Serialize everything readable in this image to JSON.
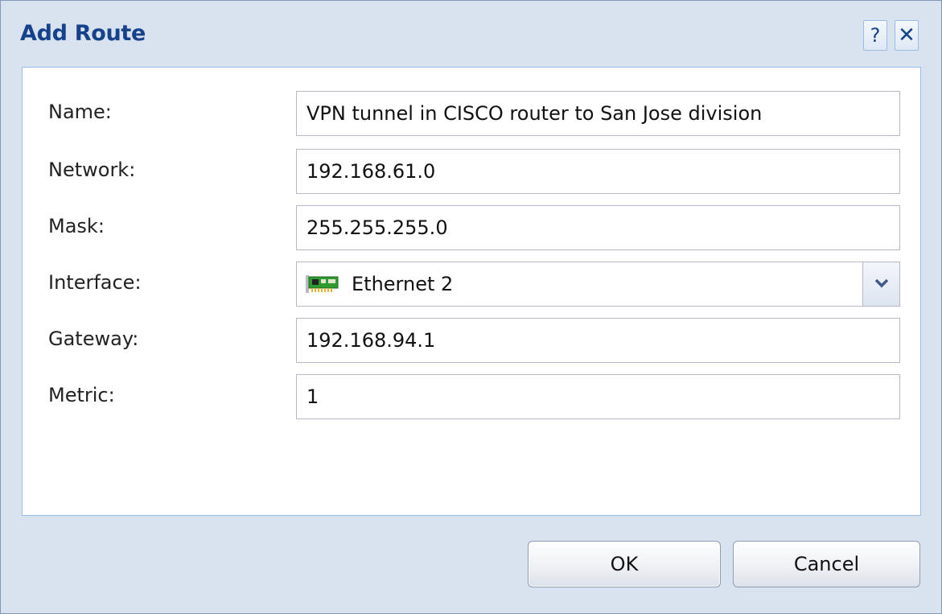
{
  "dialog": {
    "title": "Add Route",
    "help_button": "?",
    "close_button": "✕"
  },
  "form": {
    "name": {
      "label": "Name:",
      "value": "VPN tunnel in CISCO router to San Jose division"
    },
    "network": {
      "label": "Network:",
      "value": "192.168.61.0"
    },
    "mask": {
      "label": "Mask:",
      "value": "255.255.255.0"
    },
    "interface": {
      "label": "Interface:",
      "value": "Ethernet 2",
      "icon": "network-card-icon"
    },
    "gateway": {
      "label": "Gateway:",
      "value": "192.168.94.1"
    },
    "metric": {
      "label": "Metric:",
      "value": "1"
    }
  },
  "buttons": {
    "ok": "OK",
    "cancel": "Cancel"
  },
  "colors": {
    "title": "#15428b",
    "dialog_bg": "#d9e3f0",
    "panel_border": "#99bbe8"
  }
}
